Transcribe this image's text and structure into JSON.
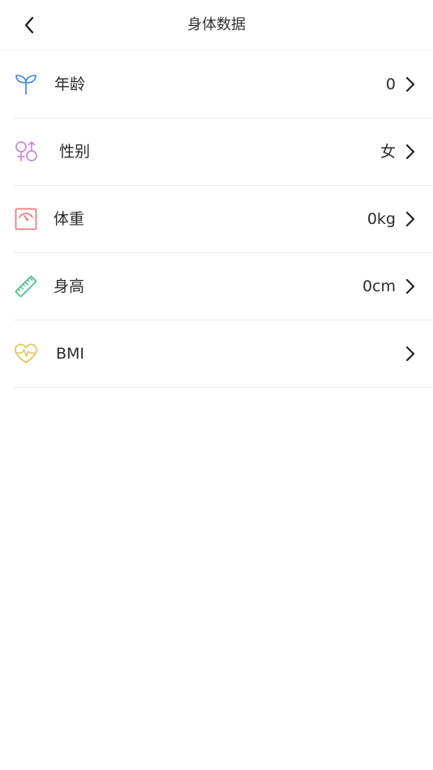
{
  "header": {
    "title": "身体数据",
    "back_icon": "chevron-left-icon"
  },
  "items": [
    {
      "label": "年龄",
      "value": "0",
      "icon": "sprout-icon",
      "color": "#4a90e2"
    },
    {
      "label": "性别",
      "value": "女",
      "icon": "gender-icon",
      "color": "#c98de0"
    },
    {
      "label": "体重",
      "value": "0kg",
      "icon": "scale-icon",
      "color": "#ef7b7b"
    },
    {
      "label": "身高",
      "value": "0cm",
      "icon": "ruler-icon",
      "color": "#4cc28a"
    },
    {
      "label": "BMI",
      "value": "",
      "icon": "heart-pulse-icon",
      "color": "#e6c55a"
    }
  ],
  "colors": {
    "text": "#2b2b2b",
    "divider": "#ececec"
  }
}
